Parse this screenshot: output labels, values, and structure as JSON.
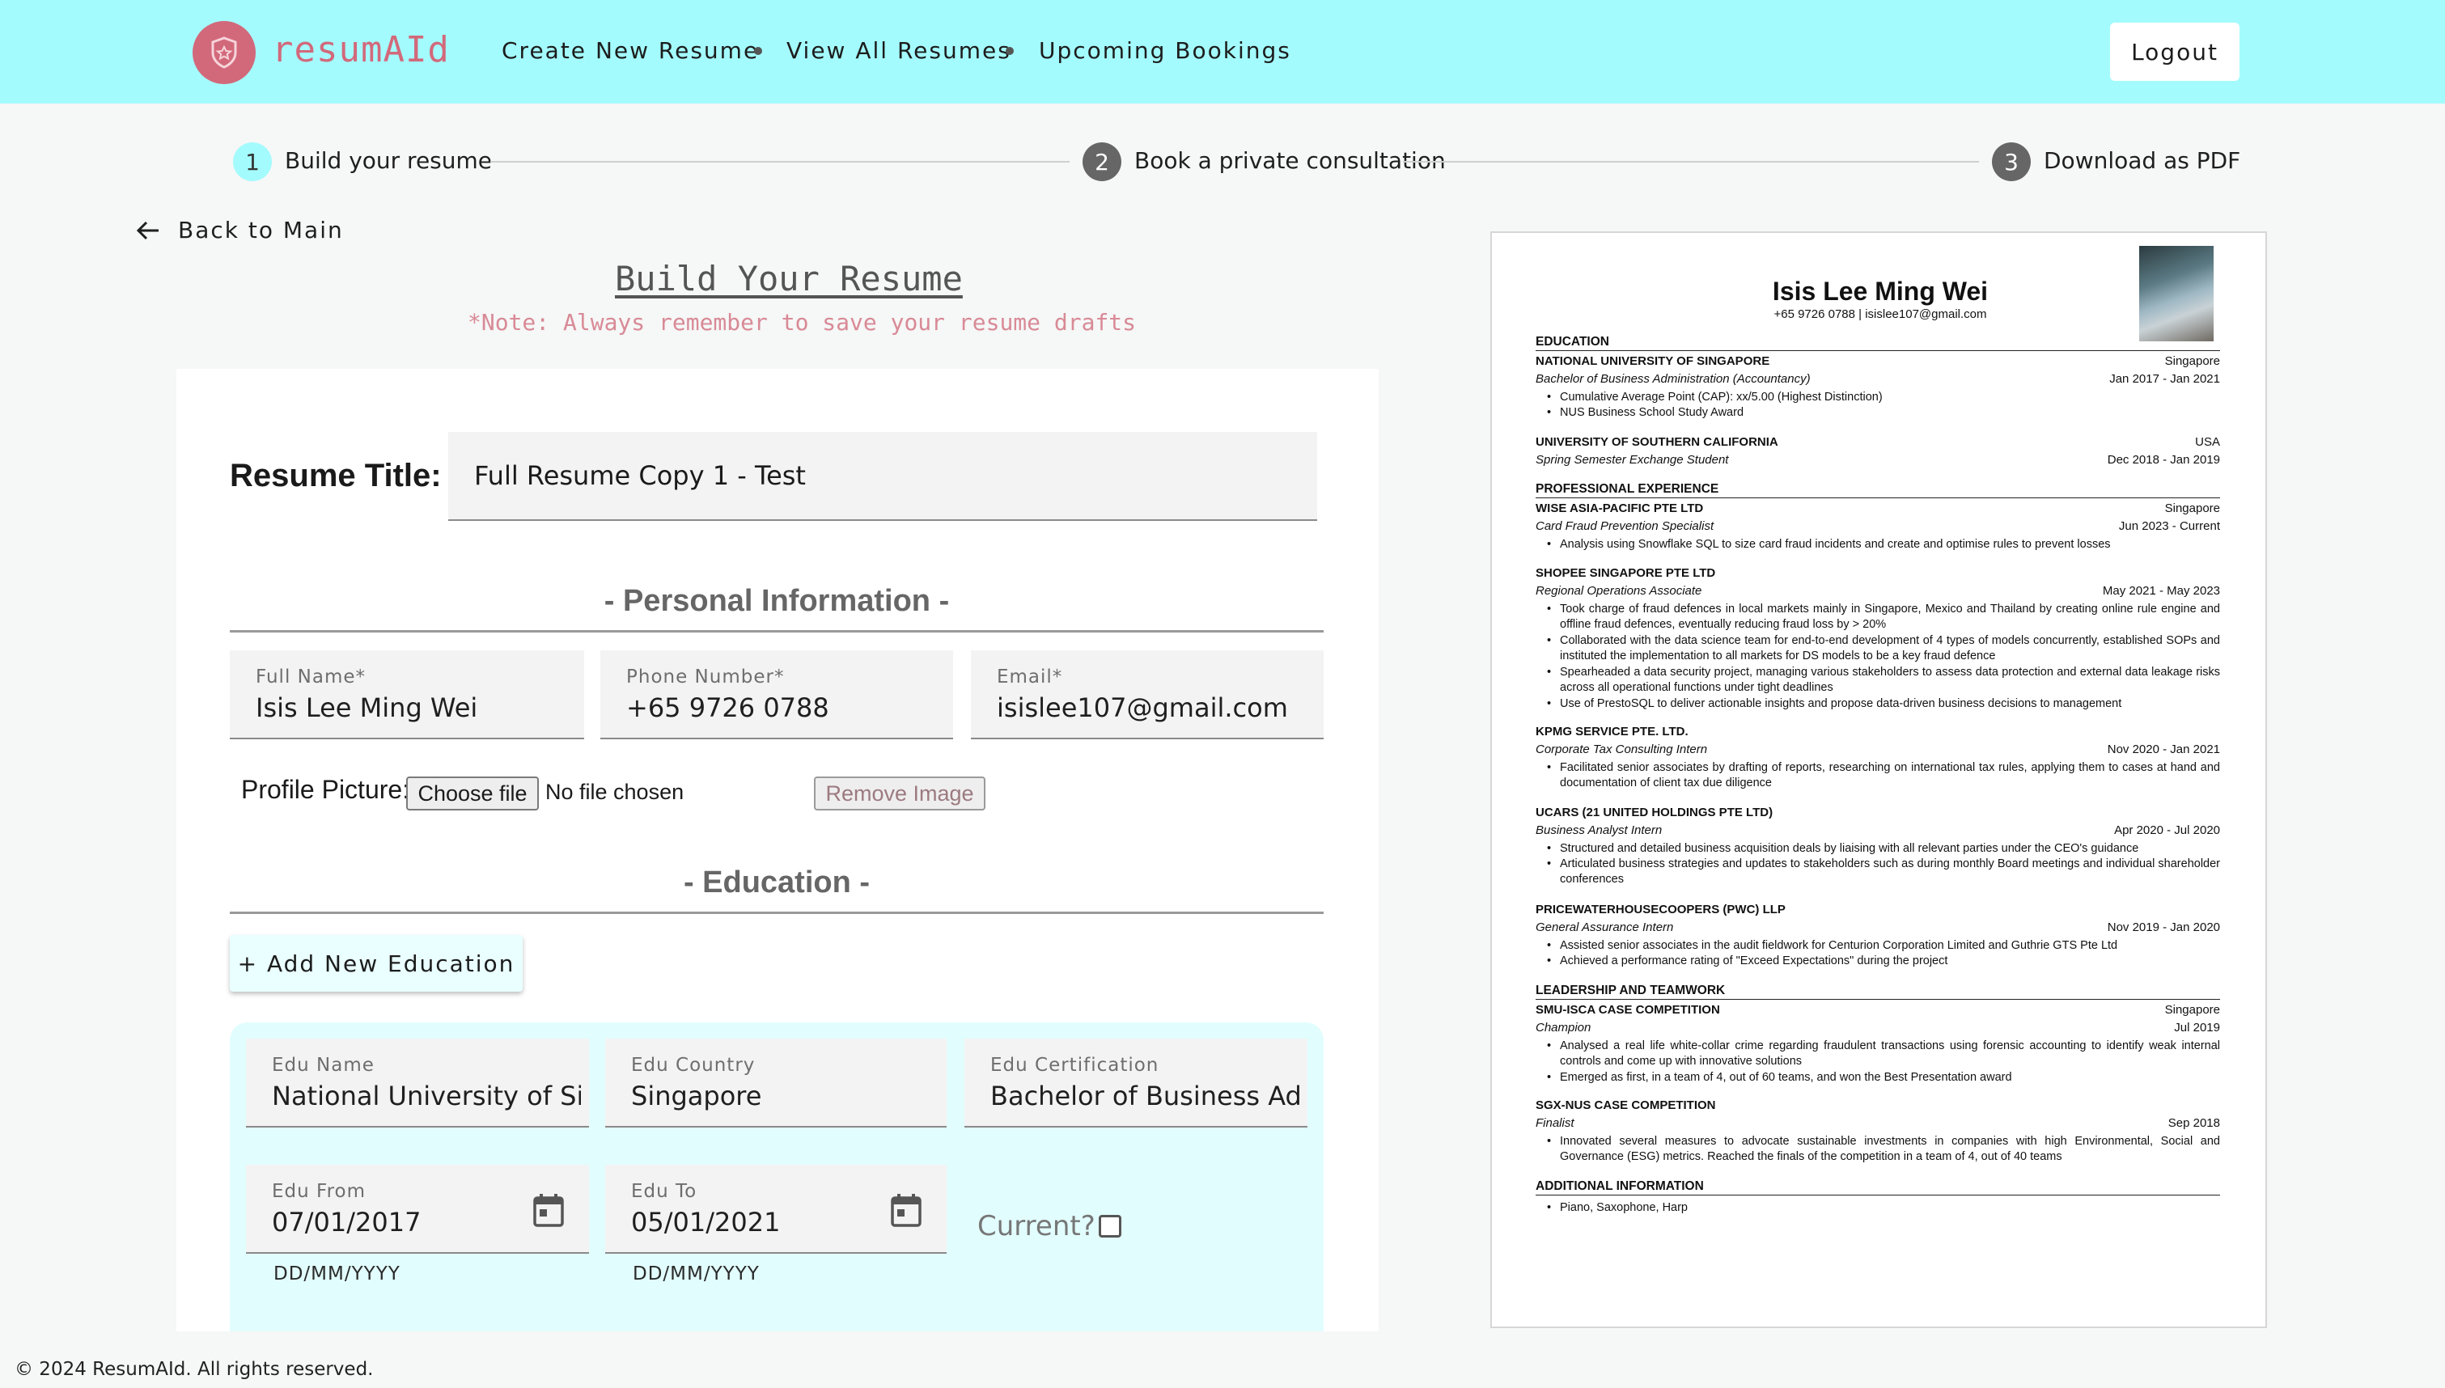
{
  "brand": {
    "name": "resumAId",
    "accent": "#d2697b",
    "nav_bg": "#a4fbfd"
  },
  "nav": {
    "links": [
      "Create New Resume",
      "View All Resumes",
      "Upcoming Bookings"
    ],
    "logout": "Logout"
  },
  "stepper": {
    "steps": [
      {
        "number": "1",
        "label": "Build your resume",
        "active": true
      },
      {
        "number": "2",
        "label": "Book a private consultation",
        "active": false
      },
      {
        "number": "3",
        "label": "Download as PDF",
        "active": false
      }
    ]
  },
  "back_link": "Back to Main",
  "page": {
    "title": "Build Your Resume",
    "note": "*Note: Always remember to save your resume drafts"
  },
  "form": {
    "resume_title_label": "Resume Title:",
    "resume_title_value": "Full Resume Copy 1 - Test",
    "personal_heading": "- Personal Information -",
    "full_name": {
      "label": "Full Name*",
      "value": "Isis Lee Ming Wei"
    },
    "phone": {
      "label": "Phone Number*",
      "value": "+65 9726 0788"
    },
    "email": {
      "label": "Email*",
      "value": "isislee107@gmail.com"
    },
    "profile_picture_label": "Profile Picture:",
    "choose_file": "Choose file",
    "no_file": "No file chosen",
    "remove_image": "Remove Image",
    "education_heading": "- Education -",
    "add_education": "+ Add New Education",
    "edu": {
      "name": {
        "label": "Edu Name",
        "value": "National University of Singapore"
      },
      "country": {
        "label": "Edu Country",
        "value": "Singapore"
      },
      "certification": {
        "label": "Edu Certification",
        "value": "Bachelor of Business Administration (Accountancy)"
      },
      "from": {
        "label": "Edu From",
        "value": "07/01/2017",
        "hint": "DD/MM/YYYY"
      },
      "to": {
        "label": "Edu To",
        "value": "05/01/2021",
        "hint": "DD/MM/YYYY"
      },
      "current_label": "Current?",
      "current_checked": false
    }
  },
  "footer": "© 2024 ResumAId. All rights reserved.",
  "preview": {
    "name": "Isis Lee Ming Wei",
    "contact": "+65 9726 0788 | isislee107@gmail.com",
    "sections": {
      "education": "EDUCATION",
      "experience": "PROFESSIONAL EXPERIENCE",
      "leadership": "LEADERSHIP AND TEAMWORK",
      "additional": "ADDITIONAL INFORMATION"
    },
    "edu1": {
      "org": "NATIONAL UNIVERSITY OF SINGAPORE",
      "loc": "Singapore",
      "role": "Bachelor of Business Administration (Accountancy)",
      "date": "Jan 2017 - Jan 2021",
      "b1": "Cumulative Average Point (CAP): xx/5.00 (Highest Distinction)",
      "b2": "NUS Business School Study Award"
    },
    "edu2": {
      "org": "UNIVERSITY OF SOUTHERN CALIFORNIA",
      "loc": "USA",
      "role": "Spring Semester Exchange Student",
      "date": "Dec 2018 - Jan 2019"
    },
    "exp1": {
      "org": "WISE ASIA-PACIFIC PTE LTD",
      "loc": "Singapore",
      "role": "Card Fraud Prevention Specialist",
      "date": "Jun 2023 - Current",
      "b1": "Analysis using Snowflake SQL to size card fraud incidents and create and optimise rules to prevent losses"
    },
    "exp2": {
      "org": "SHOPEE SINGAPORE PTE LTD",
      "role": "Regional Operations Associate",
      "date": "May 2021 - May 2023",
      "b1": "Took charge of fraud defences in local markets mainly in Singapore, Mexico and Thailand by creating online rule engine and offline fraud defences, eventually reducing fraud loss by > 20%",
      "b2": "Collaborated with the data science team for end-to-end development of 4 types of models concurrently, established SOPs and instituted the implementation to all markets for DS models to be a key fraud defence",
      "b3": "Spearheaded a data security project, managing various stakeholders to assess data protection and external data leakage risks across all operational functions under tight deadlines",
      "b4": "Use of PrestoSQL to deliver actionable insights and propose data-driven business decisions to management"
    },
    "exp3": {
      "org": "KPMG SERVICE PTE. LTD.",
      "role": "Corporate Tax Consulting Intern",
      "date": "Nov 2020 - Jan 2021",
      "b1": "Facilitated senior associates by drafting of reports, researching on international tax rules, applying them to cases at hand and documentation of client tax due diligence"
    },
    "exp4": {
      "org": "UCARS (21 UNITED HOLDINGS PTE LTD)",
      "role": "Business Analyst Intern",
      "date": "Apr 2020 - Jul 2020",
      "b1": "Structured and detailed business acquisition deals by liaising with all relevant parties under the CEO's guidance",
      "b2": "Articulated business strategies and updates to stakeholders such as during monthly Board meetings and individual shareholder conferences"
    },
    "exp5": {
      "org": "PRICEWATERHOUSECOOPERS (PWC) LLP",
      "role": "General Assurance Intern",
      "date": "Nov 2019 - Jan 2020",
      "b1": "Assisted senior associates in the audit fieldwork for Centurion Corporation Limited and Guthrie GTS Pte Ltd",
      "b2": "Achieved a performance rating of \"Exceed Expectations\" during the project"
    },
    "lead1": {
      "org": "SMU-ISCA CASE COMPETITION",
      "loc": "Singapore",
      "role": "Champion",
      "date": "Jul 2019",
      "b1": "Analysed a real life white-collar crime regarding fraudulent transactions using forensic accounting to identify weak internal controls and come up with innovative solutions",
      "b2": "Emerged as first, in a team of 4, out of 60 teams, and won the Best Presentation award"
    },
    "lead2": {
      "org": "SGX-NUS CASE COMPETITION",
      "role": "Finalist",
      "date": "Sep 2018",
      "b1": "Innovated several measures to advocate sustainable investments in companies with high Environmental, Social and Governance (ESG) metrics. Reached the finals of the competition in a team of 4, out of 40 teams"
    },
    "additional_b1": "Piano, Saxophone, Harp"
  }
}
